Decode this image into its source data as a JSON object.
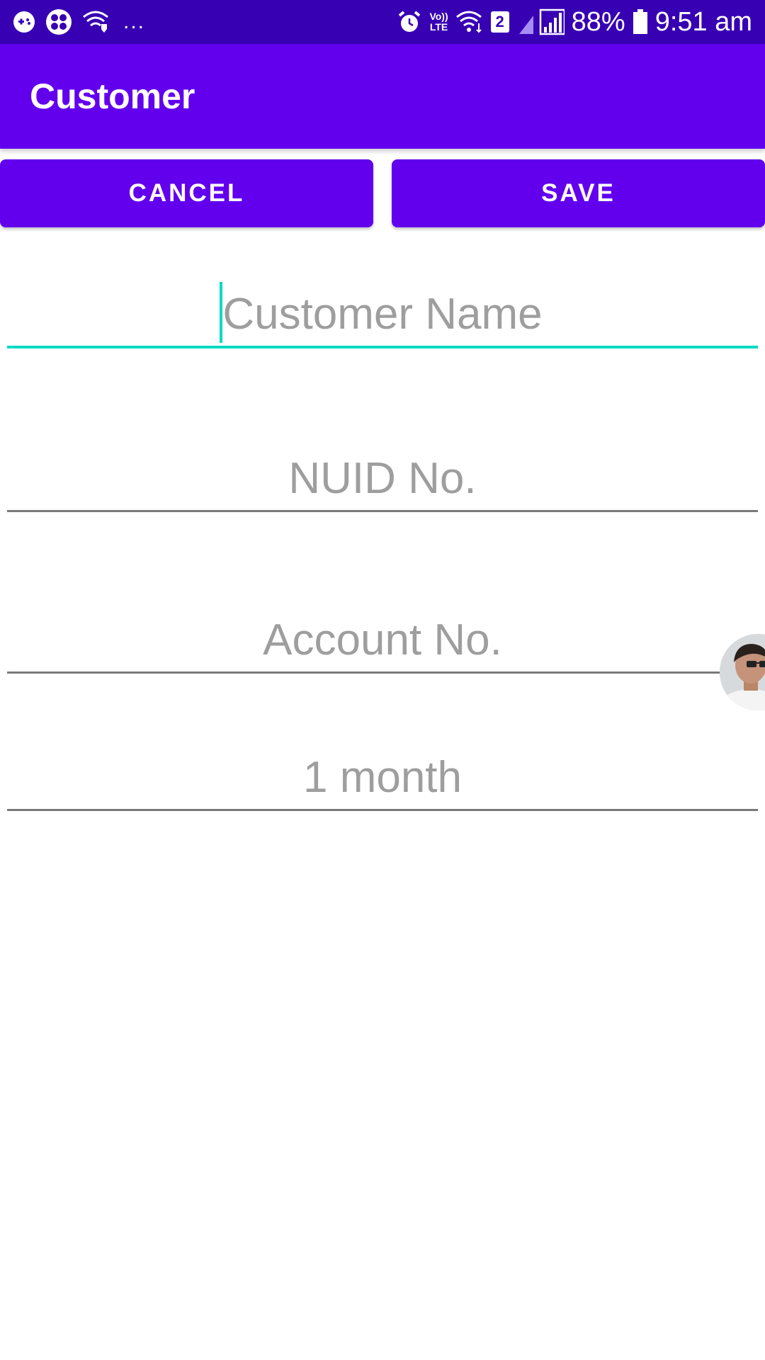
{
  "status_bar": {
    "notification_icons": [
      "game-controller-icon",
      "clover-app-icon",
      "wifi-shield-icon"
    ],
    "overflow": "...",
    "system_icons": [
      "alarm-icon",
      "volte-icon",
      "wifi-data-icon",
      "sim-icon",
      "signal-icon",
      "battery-icon"
    ],
    "volte_top": "Vo))",
    "volte_bottom": "LTE",
    "sim_number": "2",
    "battery": "88%",
    "time": "9:51 am"
  },
  "app_bar": {
    "title": "Customer"
  },
  "actions": {
    "cancel_label": "CANCEL",
    "save_label": "SAVE"
  },
  "form": {
    "customer_name": {
      "value": "",
      "placeholder": "Customer Name"
    },
    "nuid": {
      "value": "",
      "placeholder": "NUID No."
    },
    "account": {
      "value": "",
      "placeholder": "Account No."
    },
    "period": {
      "value": "",
      "placeholder": "1 month"
    }
  },
  "colors": {
    "status_bar": "#3700b3",
    "primary": "#6200ee",
    "accent": "#03dac5",
    "hint": "#9e9e9e",
    "underline": "#7a7a7a"
  }
}
